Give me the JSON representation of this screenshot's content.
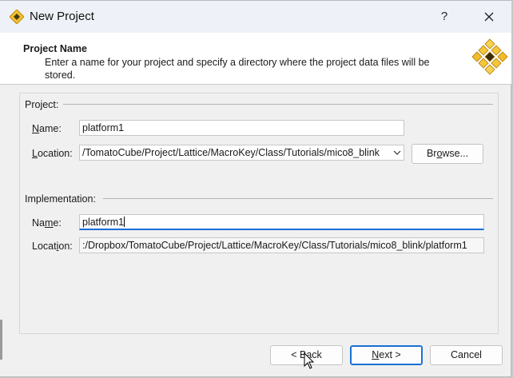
{
  "window": {
    "title": "New Project",
    "help_label": "?",
    "close_icon": "close-icon"
  },
  "header": {
    "title": "Project Name",
    "description": "Enter a name for your project and specify a directory where the project data files will be stored."
  },
  "project": {
    "group_label": "Project:",
    "name_label_pre": "",
    "name_label_u": "N",
    "name_label_post": "ame:",
    "name_value": "platform1",
    "location_label_pre": "",
    "location_label_u": "L",
    "location_label_post": "ocation:",
    "location_value": "/TomatoCube/Project/Lattice/MacroKey/Class/Tutorials/mico8_blink",
    "browse_label_pre": "Br",
    "browse_label_u": "o",
    "browse_label_post": "wse..."
  },
  "implementation": {
    "group_label": "Implementation:",
    "name_label_pre": "Na",
    "name_label_u": "m",
    "name_label_post": "e:",
    "name_value": "platform1",
    "location_label_pre": "Locat",
    "location_label_u": "i",
    "location_label_post": "on:",
    "location_value": ":/Dropbox/TomatoCube/Project/Lattice/MacroKey/Class/Tutorials/mico8_blink/platform1"
  },
  "footer": {
    "back_label": "< Back",
    "next_label_pre": "",
    "next_label_u": "N",
    "next_label_post": "ext >",
    "cancel_label": "Cancel"
  },
  "colors": {
    "accent": "#1a6fd6",
    "dialog_bg": "#f0f0f0",
    "titlebar_bg": "#eef2f8"
  }
}
